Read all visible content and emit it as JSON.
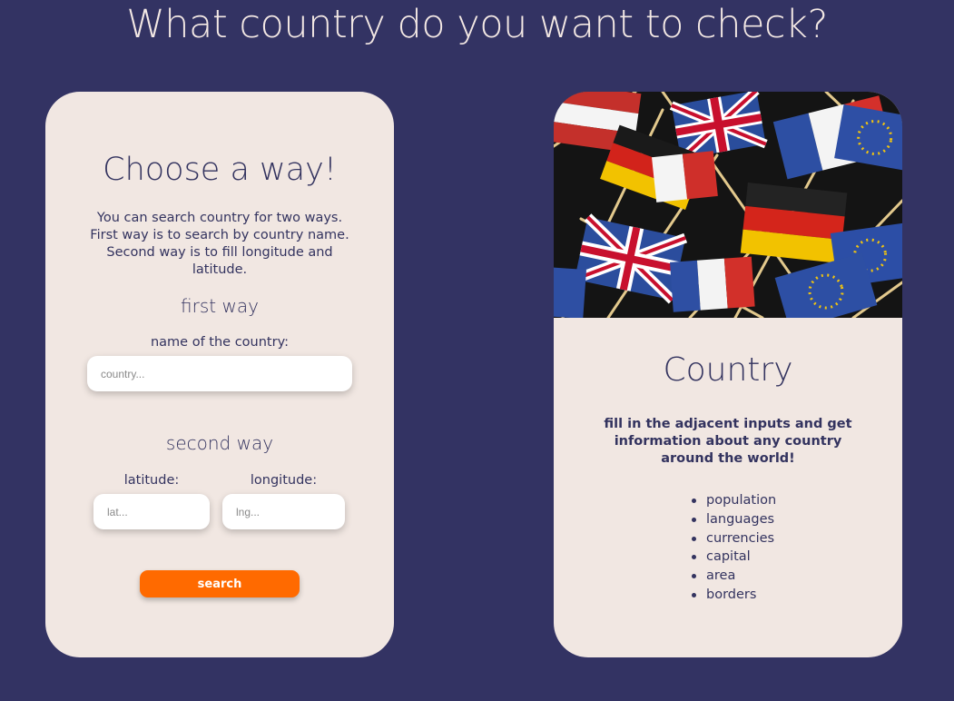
{
  "page": {
    "title": "What country do you want to check?"
  },
  "search_card": {
    "heading": "Choose a way!",
    "intro": "You can search country for two ways. First way is to search by country name. Second way is to fill longitude and latitude.",
    "first_way": {
      "title": "first way",
      "country_label": "name of the country:",
      "country_placeholder": "country...",
      "country_value": ""
    },
    "second_way": {
      "title": "second way",
      "latitude_label": "latitude:",
      "latitude_placeholder": "lat...",
      "latitude_value": "",
      "longitude_label": "longitude:",
      "longitude_placeholder": "lng...",
      "longitude_value": ""
    },
    "search_label": "search"
  },
  "info_card": {
    "image_icon": "flags-photo",
    "title": "Country",
    "description": "fill in the adjacent inputs and get information about any country around the world!",
    "features": [
      "population",
      "languages",
      "currencies",
      "capital",
      "area",
      "borders"
    ]
  },
  "colors": {
    "background": "#333363",
    "card": "#f1e7e2",
    "text": "#33335f",
    "accent": "#ff6a00"
  }
}
